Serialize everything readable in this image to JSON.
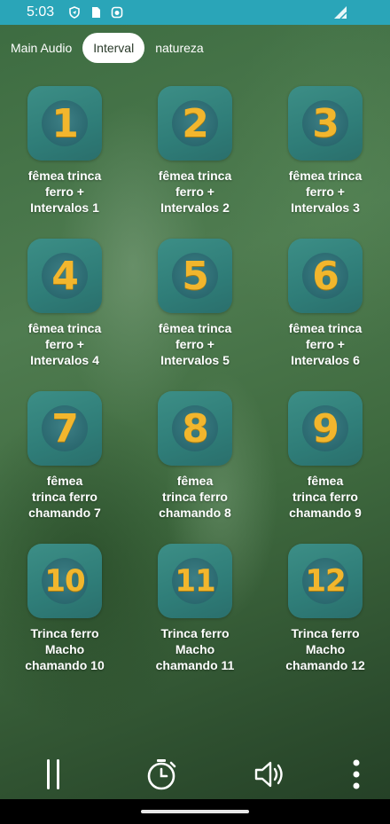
{
  "status_bar": {
    "time": "5:03",
    "icons": [
      "shield-icon",
      "sim-card-icon",
      "app-notification-icon"
    ],
    "signal_icon": "signal-icon"
  },
  "tabs": [
    {
      "label": "Main Audio",
      "active": false
    },
    {
      "label": "Interval",
      "active": true
    },
    {
      "label": "natureza",
      "active": false
    }
  ],
  "items": [
    {
      "number": "1",
      "label": "fêmea trinca\nferro +\nIntervalos 1"
    },
    {
      "number": "2",
      "label": "fêmea trinca\nferro +\nIntervalos 2"
    },
    {
      "number": "3",
      "label": "fêmea trinca\nferro +\nIntervalos 3"
    },
    {
      "number": "4",
      "label": "fêmea trinca\nferro +\nIntervalos 4"
    },
    {
      "number": "5",
      "label": "fêmea trinca\nferro +\nIntervalos 5"
    },
    {
      "number": "6",
      "label": "fêmea trinca\nferro +\nIntervalos 6"
    },
    {
      "number": "7",
      "label": "fêmea\ntrinca ferro\nchamando 7"
    },
    {
      "number": "8",
      "label": "fêmea\ntrinca ferro\nchamando 8"
    },
    {
      "number": "9",
      "label": "fêmea\ntrinca ferro\nchamando 9"
    },
    {
      "number": "10",
      "label": "Trinca ferro\nMacho\nchamando 10"
    },
    {
      "number": "11",
      "label": "Trinca ferro\nMacho\nchamando 11"
    },
    {
      "number": "12",
      "label": "Trinca ferro\nMacho\nchamando 12"
    }
  ],
  "controls": {
    "pause_icon": "pause-icon",
    "timer_icon": "timer-icon",
    "volume_icon": "volume-icon",
    "menu_icon": "more-vert-icon"
  },
  "colors": {
    "status_bar": "#2aa5b8",
    "tile": "#2f7d78",
    "number": "#f2b62d",
    "tab_active_bg": "#ffffff"
  }
}
